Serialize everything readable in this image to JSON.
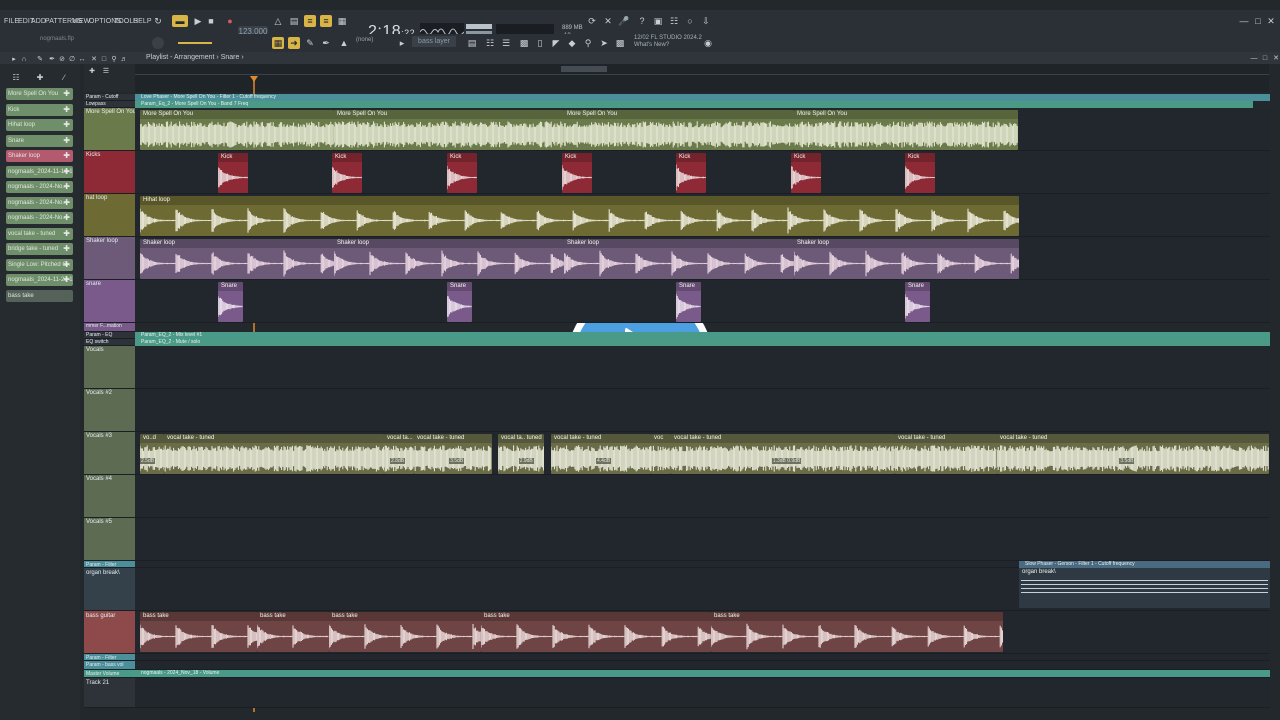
{
  "menu": [
    "FILE",
    "EDIT",
    "ADD",
    "PATTERNS",
    "VIEW",
    "OPTIONS",
    "TOOLS",
    "HELP"
  ],
  "transport": {
    "tempo": "123.000",
    "time": "2:18",
    "time_small": ":22",
    "cpu_mem": "889 MB",
    "cpu_num": "10"
  },
  "project_file": "nogmaals.flp",
  "fl_version": {
    "line1": "12/02  FL STUDIO 2024.2",
    "line2": "What's New?"
  },
  "pattern_select": "(none)",
  "pattern_name": "bass layer",
  "playlist": {
    "breadcrumb": "Playlist - Arrangement › Snare ›"
  },
  "picker": [
    {
      "label": "More Spell On You",
      "color": "#6f8f6a"
    },
    {
      "label": "Kick",
      "color": "#6f8f6a"
    },
    {
      "label": "Hihat loop",
      "color": "#6f8f6a"
    },
    {
      "label": "Snare",
      "color": "#6f8f6a"
    },
    {
      "label": "Shaker loop",
      "color": "#b45a6e"
    },
    {
      "label": "nogmaals_2024-11-18 1..",
      "color": "#6f8f6a"
    },
    {
      "label": "nogmaals - 2024-No..",
      "color": "#6f8f6a"
    },
    {
      "label": "nogmaals - 2024-No..",
      "color": "#6f8f6a"
    },
    {
      "label": "nogmaals - 2024-No..",
      "color": "#6f8f6a"
    },
    {
      "label": "vocal take - tuned",
      "color": "#6f8f6a"
    },
    {
      "label": "bridge take - tuned",
      "color": "#6f8f6a"
    },
    {
      "label": "Single Low: Pitched C..",
      "color": "#6f8f6a"
    },
    {
      "label": "nogmaals_2024-11-22 1..",
      "color": "#6f8f6a"
    },
    {
      "label": "bass take",
      "color": "#6f8f6a"
    }
  ],
  "automation_top": [
    {
      "header": "Param - Cutoff",
      "label": "Love Phaser - More Spell On You - Filter 1 - Cutoff frequency",
      "color": "#4a8f9a"
    },
    {
      "header": "Lowpass",
      "label": "Param_Eq_2 - More Spell On You - Band 7 Freq",
      "color": "#4a9a86"
    }
  ],
  "tracks": [
    {
      "name": "More Spell On You",
      "clip": "More Spell On You",
      "color": "#6b7a4a",
      "wave": "#e8ecd6"
    },
    {
      "name": "Kicks",
      "clip": "Kick",
      "color": "#8e2a36",
      "wave": "#f0e2e2"
    },
    {
      "name": "hat loop",
      "clip": "Hihat loop",
      "color": "#6d6a34",
      "wave": "#f2f0e0"
    },
    {
      "name": "Shaker loop",
      "clip": "Shaker loop",
      "color": "#6c5a78",
      "wave": "#f1dce8"
    },
    {
      "name": "snare",
      "clip": "Snare",
      "color": "#7a5a8a",
      "wave": "#f0e6f2"
    }
  ],
  "automation_mid": [
    {
      "header": "mmer F...mation",
      "label": "",
      "color": "#3b4a52"
    },
    {
      "header": "Param - EQ",
      "label": "Param_EQ_2 - Mix level #1",
      "color": "#4a9a8a"
    },
    {
      "header": "EQ switch",
      "label": "Param_EQ_2 - Mute / solo",
      "color": "#4a9a86"
    }
  ],
  "vocal_tracks": [
    "Vocals",
    "Vocals #2",
    "Vocals #3",
    "Vocals #4",
    "Vocals #5"
  ],
  "vocal_clips": [
    {
      "label": "vo..d",
      "gain": "2.5dB"
    },
    {
      "label": "vocal take - tuned",
      "gain": ""
    },
    {
      "label": "vocal ta... tun",
      "gain": "2.8dB"
    },
    {
      "label": "vocal take - tuned",
      "gain": "3.5dB"
    },
    {
      "label": "vocal ta.. tuned",
      "gain": "2.9dB"
    },
    {
      "label": "vocal take - tuned",
      "gain": "4.4dB"
    },
    {
      "label": "voc",
      "gain": ""
    },
    {
      "label": "vocal take - tuned",
      "gain": "1.3dB  0.9dB"
    },
    {
      "label": "vocal take - tuned",
      "gain": ""
    },
    {
      "label": "vocal take - tuned",
      "gain": "3.5dB"
    }
  ],
  "lower_tracks": [
    {
      "header": "Param - Filter",
      "color": "#4a8f9a"
    },
    {
      "header": "organ break\\",
      "color": "#34404a"
    },
    {
      "header": "bass guitar",
      "color": "#8e4a4a"
    },
    {
      "header": "Param - Filter",
      "color": "#4a8f9a"
    },
    {
      "header": "Param - bass vol",
      "color": "#4a8f9a"
    },
    {
      "header": "Master Volume",
      "color": "#4a9a8a"
    },
    {
      "header": "Track 21",
      "color": "#2d3338"
    }
  ],
  "organ_auto": "Slow Phaser - Gerson - Filter 1 - Cutoff frequency",
  "organ_clip": "organ break\\",
  "bass_clip": "bass take",
  "master_auto": "nogmaals - 2024_Nov_18 - Volume",
  "colors": {
    "accent": "#d9b548",
    "playhead": "#e08a2c",
    "play_button": "#4c9fe0",
    "background": "#23282d"
  }
}
